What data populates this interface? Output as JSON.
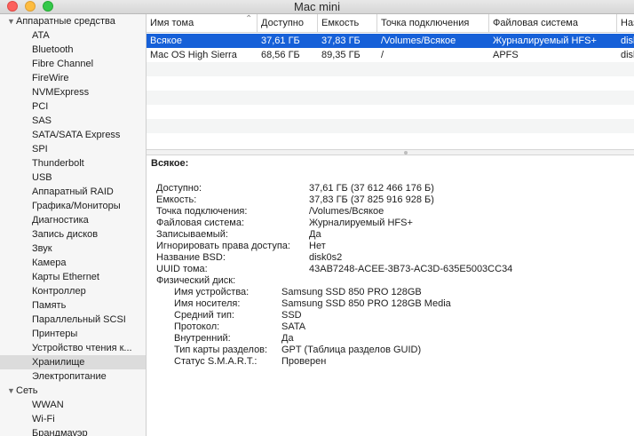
{
  "window": {
    "title": "Mac mini"
  },
  "sidebar": {
    "hardware_header": "Аппаратные средства",
    "items": [
      "ATA",
      "Bluetooth",
      "Fibre Channel",
      "FireWire",
      "NVMExpress",
      "PCI",
      "SAS",
      "SATA/SATA Express",
      "SPI",
      "Thunderbolt",
      "USB",
      "Аппаратный RAID",
      "Графика/Мониторы",
      "Диагностика",
      "Запись дисков",
      "Звук",
      "Камера",
      "Карты Ethernet",
      "Контроллер",
      "Память",
      "Параллельный SCSI",
      "Принтеры",
      "Устройство чтения к...",
      "Хранилище",
      "Электропитание"
    ],
    "selected": "Хранилище",
    "network_header": "Сеть",
    "network_items": [
      "WWAN",
      "Wi-Fi",
      "Брандмауэр"
    ]
  },
  "table": {
    "columns": [
      "Имя тома",
      "Доступно",
      "Емкость",
      "Точка подключения",
      "Файловая система",
      "Наз"
    ],
    "rows": [
      [
        "Всякое",
        "37,61 ГБ",
        "37,83 ГБ",
        "/Volumes/Всякое",
        "Журналируемый HFS+",
        "disk"
      ],
      [
        "Mac OS  High Sierra",
        "68,56 ГБ",
        "89,35 ГБ",
        "/",
        "APFS",
        "disk"
      ]
    ]
  },
  "detail": {
    "title": "Всякое:",
    "fields": [
      {
        "label": "Доступно:",
        "value": "37,61 ГБ (37 612 466 176 Б)"
      },
      {
        "label": "Емкость:",
        "value": "37,83 ГБ (37 825 916 928 Б)"
      },
      {
        "label": "Точка подключения:",
        "value": "/Volumes/Всякое"
      },
      {
        "label": "Файловая система:",
        "value": "Журналируемый HFS+"
      },
      {
        "label": "Записываемый:",
        "value": "Да"
      },
      {
        "label": "Игнорировать права доступа:",
        "value": "Нет"
      },
      {
        "label": "Название BSD:",
        "value": "disk0s2"
      },
      {
        "label": "UUID тома:",
        "value": "43AB7248-ACEE-3B73-AC3D-635E5003CC34"
      }
    ],
    "physical_label": "Физический диск:",
    "physical": [
      {
        "label": "Имя устройства:",
        "value": "Samsung SSD 850 PRO 128GB"
      },
      {
        "label": "Имя носителя:",
        "value": "Samsung SSD 850 PRO 128GB Media"
      },
      {
        "label": "Средний тип:",
        "value": "SSD"
      },
      {
        "label": "Протокол:",
        "value": "SATA"
      },
      {
        "label": "Внутренний:",
        "value": "Да"
      },
      {
        "label": "Тип карты разделов:",
        "value": "GPT (Таблица разделов GUID)"
      },
      {
        "label": "Статус S.M.A.R.T.:",
        "value": "Проверен"
      }
    ]
  }
}
